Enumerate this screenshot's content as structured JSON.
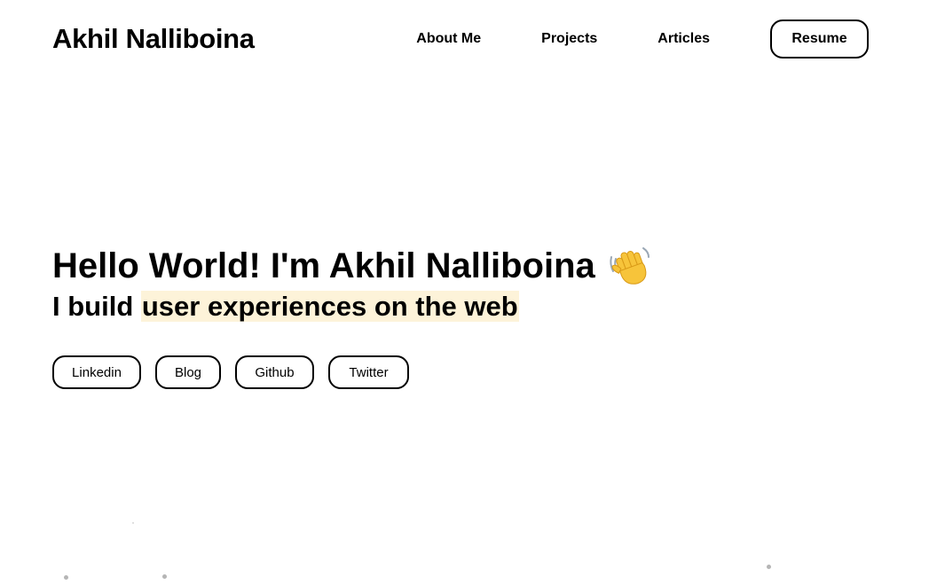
{
  "header": {
    "brand": "Akhil Nalliboina",
    "nav": {
      "about": "About Me",
      "projects": "Projects",
      "articles": "Articles",
      "resume": "Resume"
    }
  },
  "hero": {
    "title": "Hello World! I'm Akhil Nalliboina",
    "wave_icon": "waving-hand-emoji",
    "subtitle_prefix": "I build ",
    "subtitle_highlight": "user experiences on the web",
    "highlight_color": "#fdf3d9"
  },
  "socials": {
    "linkedin": "Linkedin",
    "blog": "Blog",
    "github": "Github",
    "twitter": "Twitter"
  }
}
